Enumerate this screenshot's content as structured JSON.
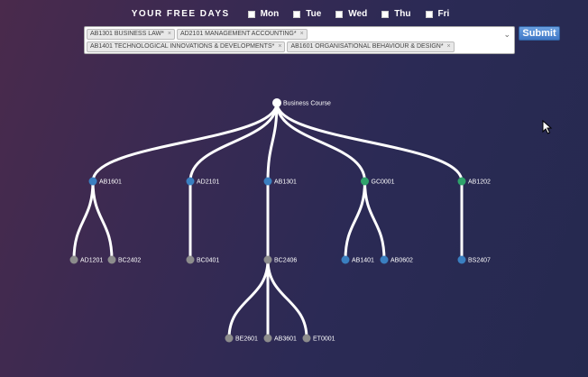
{
  "free_days": {
    "title": "YOUR FREE DAYS",
    "days": [
      "Mon",
      "Tue",
      "Wed",
      "Thu",
      "Fri"
    ]
  },
  "select": {
    "chips": [
      "AB1301 BUSINESS LAW*",
      "AD2101 MANAGEMENT ACCOUNTING*",
      "AB1401 TECHNOLOGICAL INNOVATIONS & DEVELOPMENTS*",
      "AB1601 ORGANISATIONAL BEHAVIOUR & DESIGN*"
    ],
    "remove_glyph": "×"
  },
  "submit_label": "Submit",
  "tree": {
    "root": "Business Course",
    "colors": {
      "blue": "#3a7fc0",
      "green": "#2fa36b",
      "grey": "#8c8c8c",
      "root": "#ffffff"
    },
    "nodes": [
      {
        "id": "AB1601",
        "color": "blue",
        "children": [
          {
            "id": "AD1201",
            "color": "grey"
          },
          {
            "id": "BC2402",
            "color": "grey"
          }
        ]
      },
      {
        "id": "AD2101",
        "color": "blue",
        "children": [
          {
            "id": "BC0401",
            "color": "grey"
          }
        ]
      },
      {
        "id": "AB1301",
        "color": "blue",
        "children": [
          {
            "id": "BC2406",
            "color": "grey",
            "children": [
              {
                "id": "BE2601",
                "color": "grey"
              },
              {
                "id": "AB3601",
                "color": "grey"
              },
              {
                "id": "ET0001",
                "color": "grey"
              }
            ]
          }
        ]
      },
      {
        "id": "GC0001",
        "color": "green",
        "children": [
          {
            "id": "AB1401",
            "color": "blue"
          },
          {
            "id": "AB0602",
            "color": "blue"
          }
        ]
      },
      {
        "id": "AB1202",
        "color": "green",
        "children": [
          {
            "id": "BS2407",
            "color": "blue"
          }
        ]
      }
    ]
  }
}
